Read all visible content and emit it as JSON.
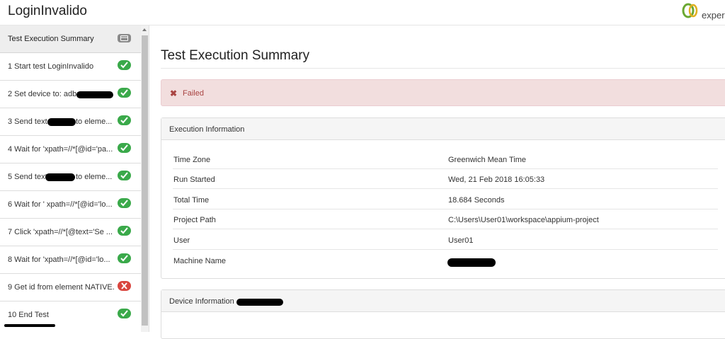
{
  "app": {
    "title": "LoginInvalido",
    "logo_text": "experit"
  },
  "sidebar": {
    "header": {
      "label": "Test Execution Summary",
      "icon": "card-icon"
    },
    "steps": [
      {
        "label": "1 Start test LoginInvalido",
        "status": "pass"
      },
      {
        "label": "2 Set device to: adb:",
        "status": "pass"
      },
      {
        "label": "3 Send text",
        "label_suffix": "to eleme...",
        "status": "pass"
      },
      {
        "label": "4 Wait for 'xpath=//*[@id='pa...",
        "status": "pass"
      },
      {
        "label": "5 Send text",
        "label_suffix": "to eleme...",
        "status": "pass"
      },
      {
        "label": "6 Wait for ' xpath=//*[@id='lo...",
        "status": "pass"
      },
      {
        "label": "7 Click 'xpath=//*[@text='Se ...",
        "status": "pass"
      },
      {
        "label": "8 Wait for 'xpath=//*[@id='lo...",
        "status": "pass"
      },
      {
        "label": "9 Get id from element NATIVE...",
        "status": "fail"
      },
      {
        "label": "10 End Test",
        "status": "pass"
      }
    ]
  },
  "main": {
    "title": "Test Execution Summary",
    "alert": {
      "icon": "x-icon",
      "text": "Failed",
      "color": "#a94442"
    },
    "execution_panel": {
      "title": "Execution Information",
      "rows": [
        {
          "key": "Time Zone",
          "value": "Greenwich Mean Time"
        },
        {
          "key": "Run Started",
          "value": "Wed, 21 Feb 2018 16:05:33"
        },
        {
          "key": "Total Time",
          "value": "18.684 Seconds"
        },
        {
          "key": "Project Path",
          "value": "C:\\Users\\User01\\workspace\\appium-project"
        },
        {
          "key": "User",
          "value": "User01"
        },
        {
          "key": "Machine Name",
          "value": ""
        }
      ]
    },
    "device_panel": {
      "title": "Device Information"
    }
  },
  "colors": {
    "pass": "#3aa94a",
    "fail": "#d9463f",
    "alert_bg": "#f2dede"
  }
}
